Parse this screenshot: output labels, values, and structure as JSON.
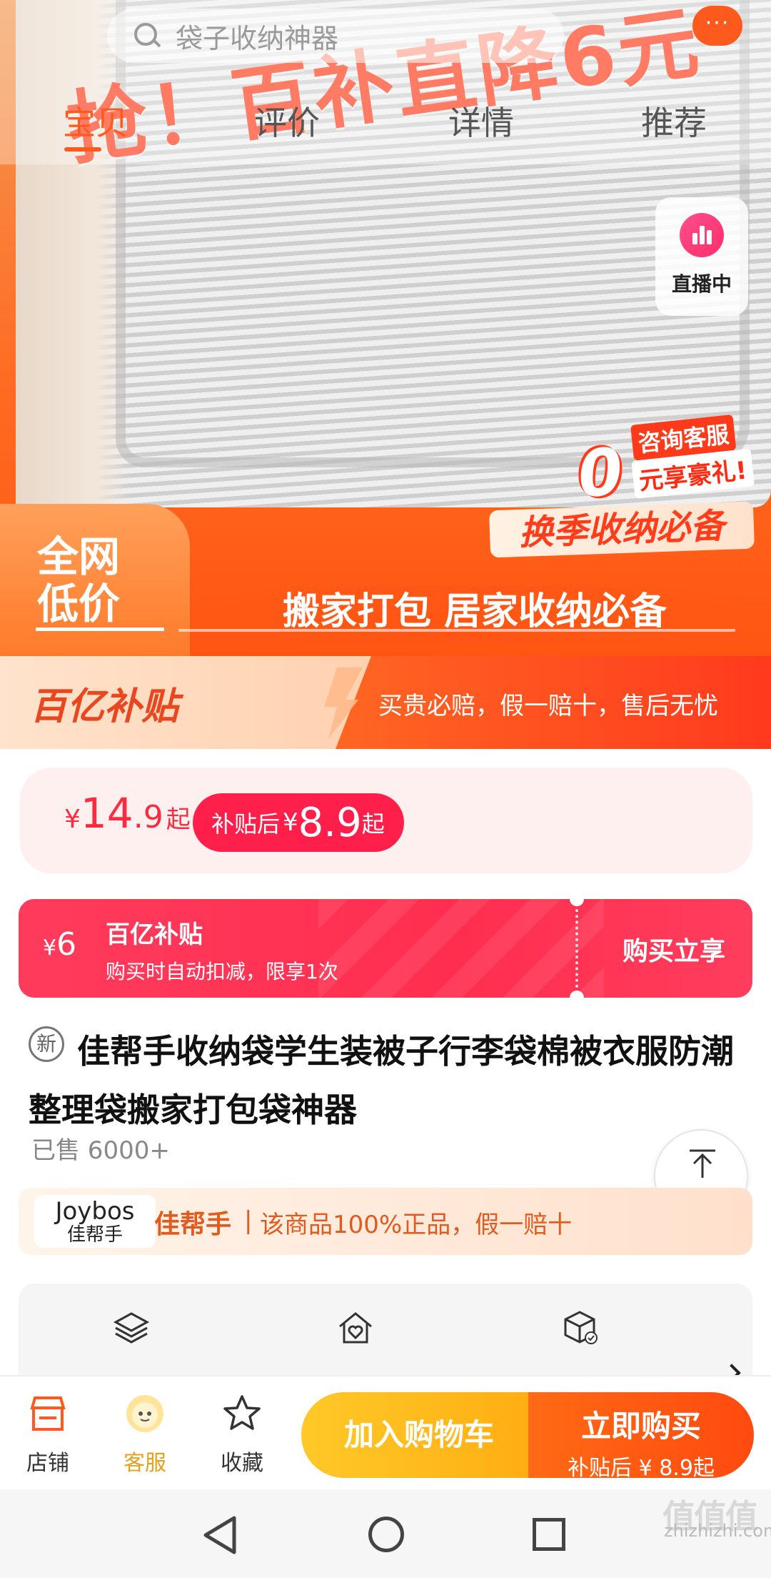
{
  "header": {
    "search_placeholder": "袋子收纳神器",
    "more_label": "···",
    "tabs": [
      {
        "label": "宝贝"
      },
      {
        "label": "评价"
      },
      {
        "label": "详情"
      },
      {
        "label": "推荐"
      }
    ]
  },
  "hero": {
    "headline": "抢！百补直降6元",
    "live_label": "直播中",
    "consult_line1": "咨询客服",
    "consult_zero": "0",
    "consult_line2": "元享豪礼!",
    "season_tag": "换季收纳必备",
    "low_price_line1": "全网",
    "low_price_line2": "低价",
    "slogan": "搬家打包 居家收纳必备"
  },
  "subsidy_banner": {
    "logo": "百亿补贴",
    "text": "买贵必赔，假一赔十，售后无忧"
  },
  "price": {
    "currency": "¥",
    "int": "14",
    "dec": ".9",
    "suffix": "起",
    "subsidy_label": "补贴后",
    "subsidy_currency": "¥",
    "subsidy_value": "8.9",
    "subsidy_suffix": "起"
  },
  "coupon": {
    "currency": "¥",
    "amount": "6",
    "title": "百亿补贴",
    "desc": "购买时自动扣减，限享1次",
    "action": "购买立享"
  },
  "product": {
    "new_badge": "新",
    "title": "佳帮手收纳袋学生装被子行李袋棉被衣服防潮整理袋搬家打包袋神器",
    "sold": "已售 6000+"
  },
  "to_top": {
    "label": "顶部"
  },
  "brand": {
    "logo_en": "Joybos",
    "logo_cn": "佳帮手",
    "name": "佳帮手",
    "separator": "|",
    "claim": "该商品100%正品，假一赔十"
  },
  "bottom_bar": {
    "shop": "店铺",
    "service": "客服",
    "favorite": "收藏",
    "add_cart": "加入购物车",
    "buy_now": "立即购买",
    "buy_sub": "补贴后 ¥ 8.9起"
  },
  "watermark": {
    "brand": "值值值",
    "url": "zhizhizhi.com"
  },
  "colors": {
    "accent": "#ff5a1e",
    "price_red": "#ff1f4a",
    "cart_yellow": "#ffc928"
  }
}
